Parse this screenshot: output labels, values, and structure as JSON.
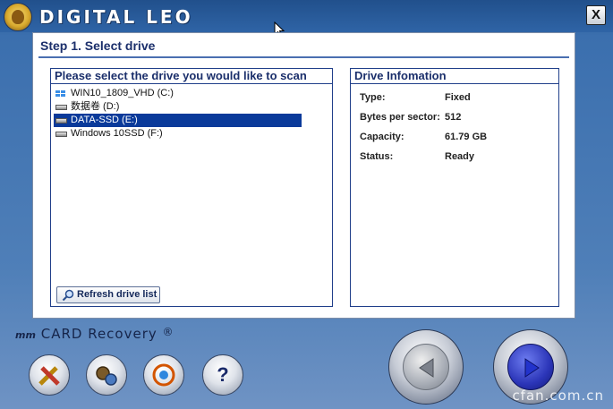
{
  "app": {
    "brand": "DIGITAL LEO",
    "close_label": "X"
  },
  "step": {
    "title": "Step 1. Select drive"
  },
  "drive_panel": {
    "heading": "Please select the drive you would like to scan",
    "drives": [
      {
        "label": "WIN10_1809_VHD (C:)",
        "icon": "windows-drive-icon",
        "selected": false
      },
      {
        "label": "数据卷 (D:)",
        "icon": "hard-drive-icon",
        "selected": false
      },
      {
        "label": "DATA-SSD (E:)",
        "icon": "hard-drive-icon",
        "selected": true
      },
      {
        "label": "Windows 10SSD (F:)",
        "icon": "hard-drive-icon",
        "selected": false
      }
    ],
    "refresh_label": "Refresh drive list"
  },
  "info_panel": {
    "heading": "Drive Infomation",
    "rows": [
      {
        "key": "Type:",
        "value": "Fixed"
      },
      {
        "key": "Bytes per sector:",
        "value": "512"
      },
      {
        "key": "Capacity:",
        "value": "61.79 GB"
      },
      {
        "key": "Status:",
        "value": "Ready"
      }
    ]
  },
  "footer": {
    "product_prefix": "mm",
    "product_name": "CARD Recovery",
    "registered": "®",
    "tools": [
      "tools-icon",
      "settings-gears-icon",
      "network-icon",
      "help-icon"
    ],
    "watermark": "cfan.com.cn"
  },
  "colors": {
    "selection": "#0a3a9a",
    "heading_text": "#1b2f6b",
    "background": "#3b6fae"
  }
}
